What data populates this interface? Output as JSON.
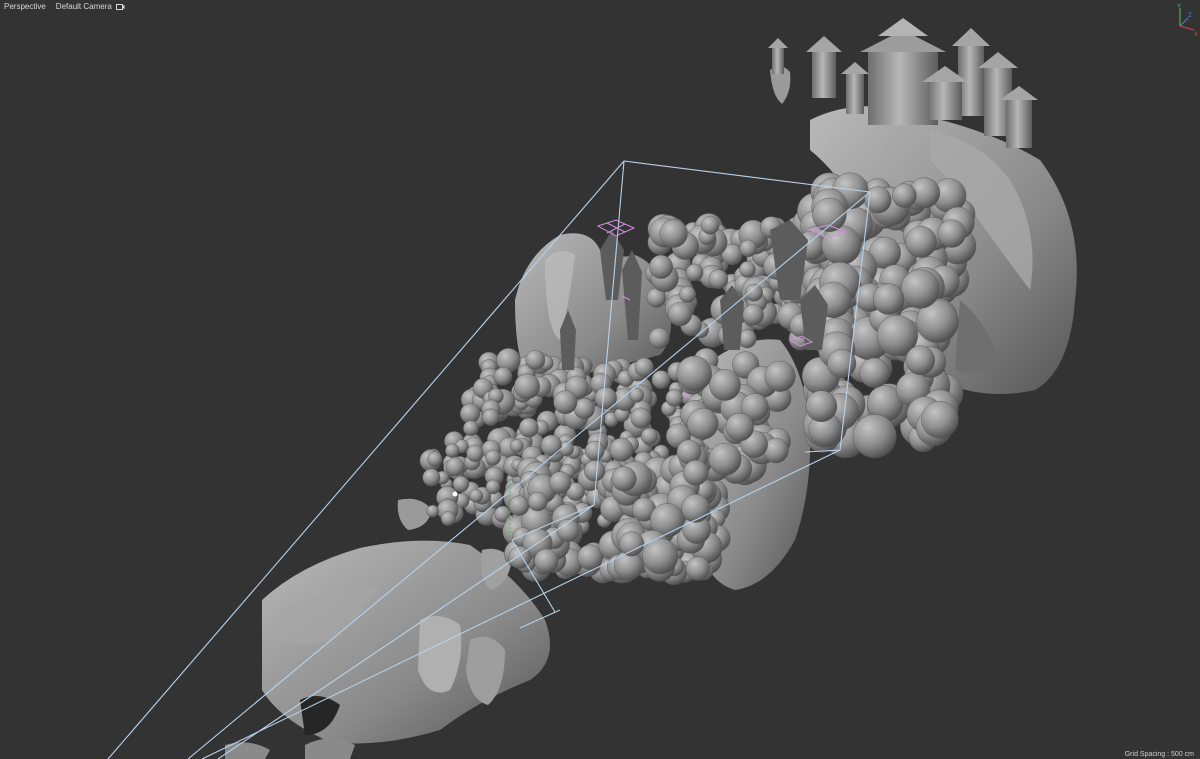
{
  "viewport": {
    "view_label": "Perspective",
    "camera_label": "Default Camera",
    "camera_icon": "camera-icon",
    "grid_spacing": "Grid Spacing : 500 cm",
    "axes": {
      "x": "X",
      "y": "Y",
      "z": "Z"
    },
    "colors": {
      "background": "#333333",
      "frustum": "#b8d2ec",
      "selection": "#d58fe0",
      "geometry": "#8f8f8f"
    }
  }
}
